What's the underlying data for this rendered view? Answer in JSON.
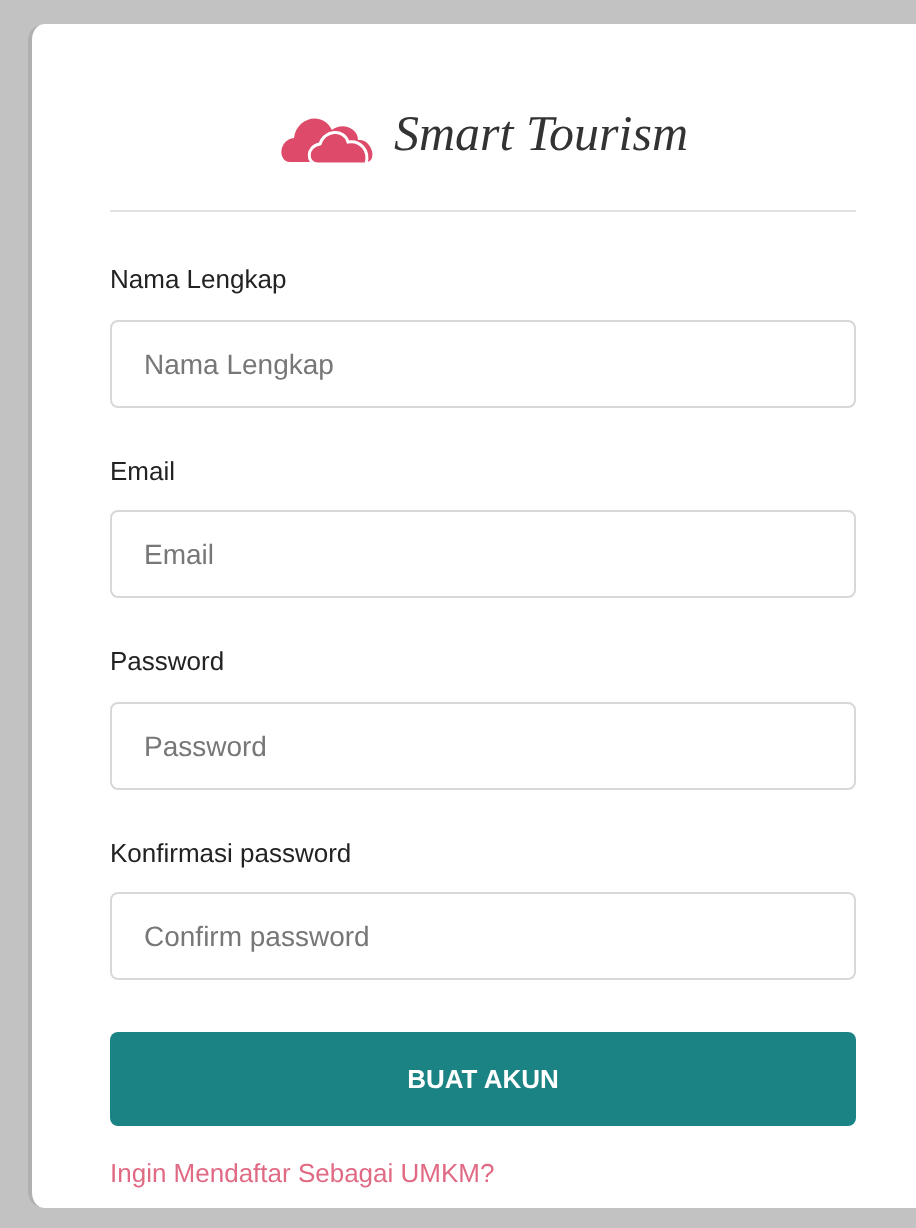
{
  "logo": {
    "text": "Smart Tourism"
  },
  "fields": [
    {
      "label": "Nama Lengkap",
      "placeholder": "Nama Lengkap"
    },
    {
      "label": "Email",
      "placeholder": "Email"
    },
    {
      "label": "Password",
      "placeholder": "Password"
    },
    {
      "label": "Konfirmasi password",
      "placeholder": "Confirm password"
    }
  ],
  "submit_button": "BUAT AKUN",
  "link": "Ingin Mendaftar Sebagai UMKM?"
}
